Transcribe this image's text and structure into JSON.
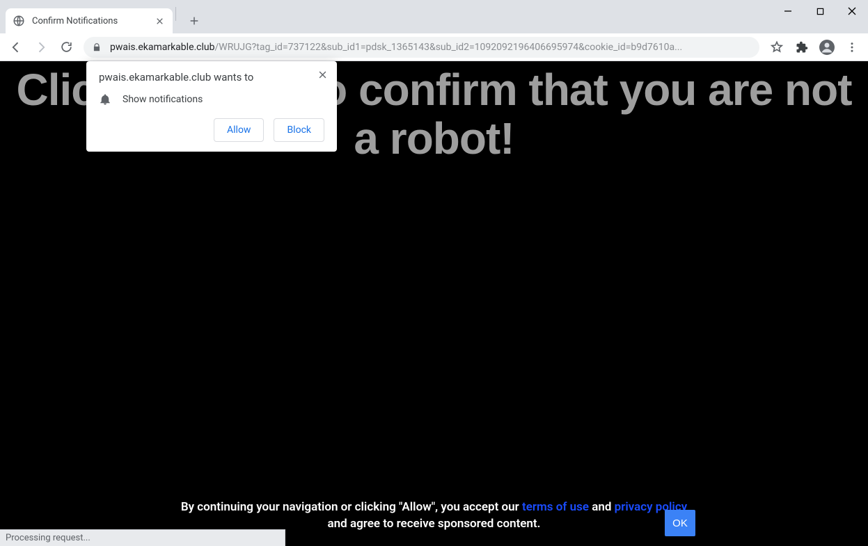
{
  "window": {
    "tab_title": "Confirm Notifications"
  },
  "omnibox": {
    "host": "pwais.ekamarkable.club",
    "path": "/WRUJG?tag_id=737122&sub_id1=pdsk_1365143&sub_id2=1092092196406695974&cookie_id=b9d7610a..."
  },
  "page": {
    "headline": "Click «Allow» to confirm that you are not a robot!"
  },
  "footer": {
    "line1_pre": "By continuing your navigation or clicking \"Allow\", you accept our ",
    "terms": "terms of use",
    "line1_mid": " and ",
    "privacy": "privacy policy",
    "line2": "and agree to receive sponsored content.",
    "ok": "OK"
  },
  "perm": {
    "header": "pwais.ekamarkable.club wants to",
    "item": "Show notifications",
    "allow": "Allow",
    "block": "Block"
  },
  "status": {
    "text": "Processing request..."
  }
}
